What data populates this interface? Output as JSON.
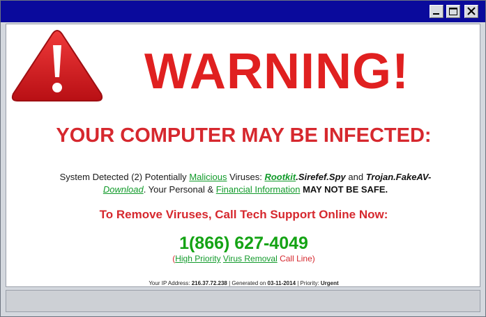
{
  "window": {
    "controls": {
      "minimize": "minimize-icon",
      "maximize": "maximize-icon",
      "close": "close-icon"
    }
  },
  "colors": {
    "title_bar": "#0a0a9c",
    "alert_red": "#d6282e",
    "link_green": "#119a2a",
    "phone_green": "#14a314"
  },
  "alert": {
    "icon": "warning-triangle-icon",
    "title": "WARNING!",
    "subtitle": "YOUR COMPUTER MAY BE INFECTED:",
    "message": {
      "p1": "System Detected (2) Potentially ",
      "link_malicious": "Malicious",
      "p2": " Viruses: ",
      "link_rootkit": "Rootkit",
      "sirefef": ".Sirefef.Spy",
      "p3": " and ",
      "trojan": "Trojan.FakeAV-",
      "link_download": "Download",
      "p4": ". Your Personal & ",
      "link_financial": "Financial Information",
      "p5": " ",
      "not_safe": "MAY NOT BE SAFE."
    },
    "call_prompt": "To Remove Viruses, Call Tech Support Online Now:",
    "phone": "1(866) 627-4049",
    "call_line": {
      "open": "(",
      "link_high": "High Priority",
      "space": " ",
      "link_virus": "Virus Removal",
      "rest": " Call Line)"
    },
    "footer": {
      "ip_label": "Your IP Address: ",
      "ip": "216.37.72.238",
      "gen_label": " | Generated on ",
      "date": "03-11-2014",
      "priority_label": " | Priority: ",
      "priority": "Urgent"
    }
  }
}
